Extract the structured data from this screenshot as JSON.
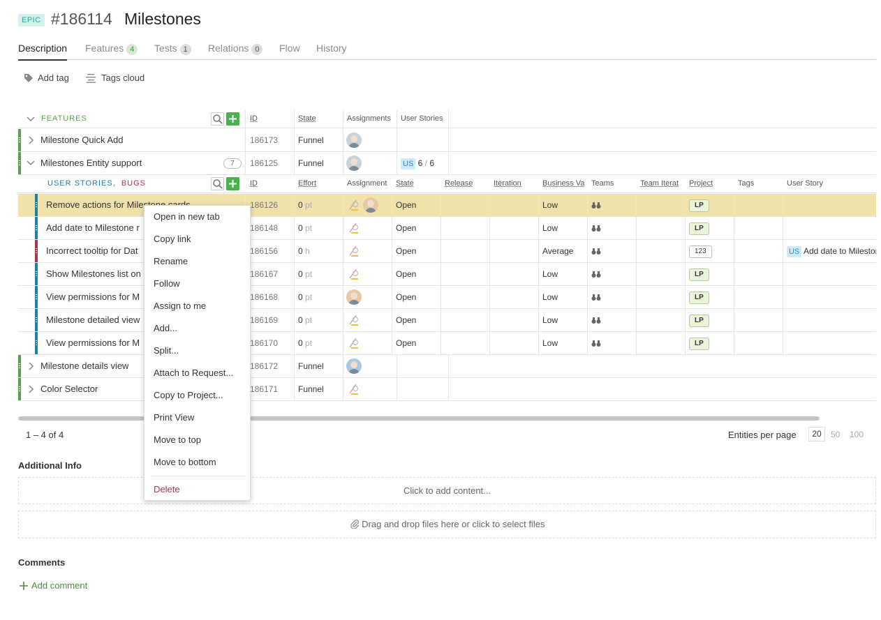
{
  "header": {
    "type_badge": "EPIC",
    "entity_id": "#186114",
    "title": "Milestones"
  },
  "tabs": [
    {
      "label": "Description",
      "count": null
    },
    {
      "label": "Features",
      "count": "4"
    },
    {
      "label": "Tests",
      "count": "1"
    },
    {
      "label": "Relations",
      "count": "0"
    },
    {
      "label": "Flow",
      "count": null
    },
    {
      "label": "History",
      "count": null
    }
  ],
  "tagbar": {
    "add_tag": "Add tag",
    "tags_cloud": "Tags cloud"
  },
  "features_grid": {
    "section_label": "FEATURES",
    "columns": {
      "id": "ID",
      "state": "State",
      "assignments": "Assignments",
      "user_stories": "User Stories"
    },
    "rows": [
      {
        "title": "Milestone Quick Add",
        "id": "186173",
        "state": "Funnel"
      },
      {
        "title": "Milestones Entity support",
        "id": "186125",
        "state": "Funnel",
        "child_count": "7",
        "user_stories": {
          "badge": "US",
          "done": "6",
          "total": "6"
        }
      },
      {
        "title": "Milestone details view",
        "id": "186172",
        "state": "Funnel"
      },
      {
        "title": "Color Selector",
        "id": "186171",
        "state": "Funnel"
      }
    ]
  },
  "stories_grid": {
    "label_stories": "USER STORIES",
    "label_sep": ",",
    "label_bugs": "BUGS",
    "columns": {
      "id": "ID",
      "effort": "Effort",
      "assignment": "Assignment",
      "state": "State",
      "release": "Release",
      "iteration": "Iteration",
      "business_value": "Business Va",
      "teams": "Teams",
      "team_iteration": "Team Iterat",
      "project": "Project",
      "tags": "Tags",
      "user_story": "User Story"
    },
    "rows": [
      {
        "title": "Remove actions for Milestone cards",
        "id": "186126",
        "effort": "0",
        "unit": "pt",
        "state": "Open",
        "bv": "Low",
        "project": "LP",
        "type": "story",
        "selected": true
      },
      {
        "title": "Add date to Milestone r",
        "id": "186148",
        "effort": "0",
        "unit": "pt",
        "state": "Open",
        "bv": "Low",
        "project": "LP",
        "type": "story"
      },
      {
        "title": "Incorrect tooltip for Dat",
        "id": "186156",
        "effort": "0",
        "unit": "h",
        "state": "Open",
        "bv": "Average",
        "project": "123",
        "type": "bug",
        "user_story_badge": "US",
        "user_story": "Add date to Mileston"
      },
      {
        "title": "Show Milestones list on",
        "id": "186167",
        "effort": "0",
        "unit": "pt",
        "state": "Open",
        "bv": "Low",
        "project": "LP",
        "type": "story"
      },
      {
        "title": "View permissions for M",
        "id": "186168",
        "effort": "0",
        "unit": "pt",
        "state": "Open",
        "bv": "Low",
        "project": "LP",
        "type": "story"
      },
      {
        "title": "Milestone detailed view",
        "id": "186169",
        "effort": "0",
        "unit": "pt",
        "state": "Open",
        "bv": "Low",
        "project": "LP",
        "type": "story"
      },
      {
        "title": "View permissions for M",
        "id": "186170",
        "effort": "0",
        "unit": "pt",
        "state": "Open",
        "bv": "Low",
        "project": "LP",
        "type": "story"
      }
    ]
  },
  "pager": {
    "range": "1 – 4 of 4",
    "per_page_label": "Entities per page",
    "options": [
      "20",
      "50",
      "100"
    ],
    "selected": "20"
  },
  "context_menu": {
    "items": [
      "Open in new tab",
      "Copy link",
      "Rename",
      "Follow",
      "Assign to me",
      "Add...",
      "Split...",
      "Attach to Request...",
      "Copy to Project...",
      "Print View",
      "Move to top",
      "Move to bottom"
    ],
    "delete": "Delete"
  },
  "additional_info": {
    "title": "Additional Info",
    "click_to_add": "Click to add content...",
    "drop_files": "Drag and drop files here or click to select files"
  },
  "comments": {
    "title": "Comments",
    "add": "Add comment"
  },
  "colors": {
    "feature_bar": "#5b9e4d",
    "story_bar": "#1f7fa8",
    "bug_bar": "#b0354a",
    "selected_row": "#f0e2aa",
    "add_green": "#4caf50"
  }
}
